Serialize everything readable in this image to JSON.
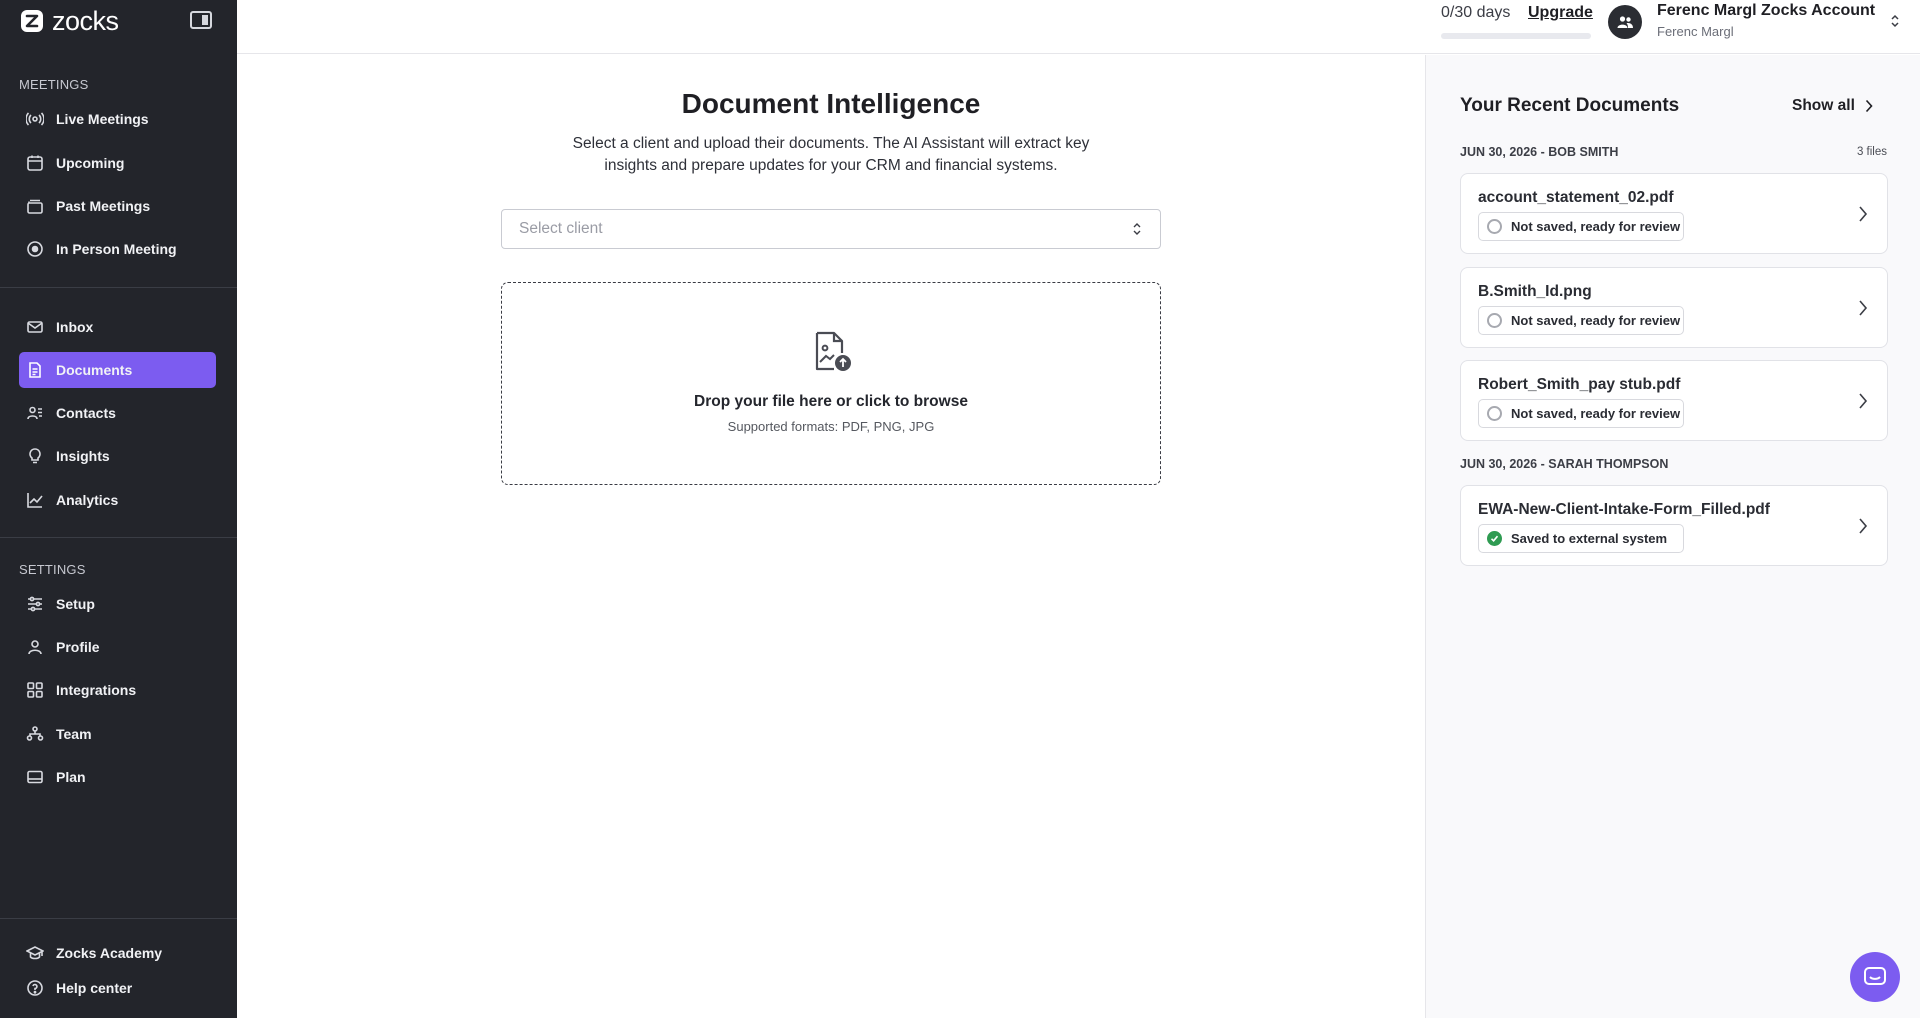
{
  "app": {
    "brand_name": "zocks"
  },
  "sidebar": {
    "meetings_label": "MEETINGS",
    "meetings_items": [
      {
        "label": "Live Meetings",
        "icon": "broadcast-icon"
      },
      {
        "label": "Upcoming",
        "icon": "calendar-icon"
      },
      {
        "label": "Past Meetings",
        "icon": "archive-icon"
      },
      {
        "label": "In Person Meeting",
        "icon": "record-icon"
      }
    ],
    "main_items": [
      {
        "label": "Inbox",
        "icon": "mail-icon"
      },
      {
        "label": "Documents",
        "icon": "document-icon",
        "active": true
      },
      {
        "label": "Contacts",
        "icon": "contacts-icon"
      },
      {
        "label": "Insights",
        "icon": "lightbulb-icon"
      },
      {
        "label": "Analytics",
        "icon": "chart-icon"
      }
    ],
    "settings_label": "SETTINGS",
    "settings_items": [
      {
        "label": "Setup",
        "icon": "sliders-icon"
      },
      {
        "label": "Profile",
        "icon": "user-icon"
      },
      {
        "label": "Integrations",
        "icon": "grid-icon"
      },
      {
        "label": "Team",
        "icon": "team-icon"
      },
      {
        "label": "Plan",
        "icon": "card-icon"
      }
    ],
    "footer_items": [
      {
        "label": "Zocks Academy",
        "icon": "graduation-icon"
      },
      {
        "label": "Help center",
        "icon": "help-icon"
      }
    ]
  },
  "topbar": {
    "trial_text": "0/30 days",
    "trial_progress": 0,
    "upgrade_label": "Upgrade",
    "account_name": "Ferenc Margl Zocks Account",
    "account_user": "Ferenc Margl"
  },
  "main": {
    "title": "Document Intelligence",
    "description": "Select a client and upload their documents. The AI Assistant will extract key insights and prepare updates for your CRM and financial systems.",
    "select_placeholder": "Select client",
    "dropzone_title": "Drop your file here or click to browse",
    "dropzone_formats": "Supported formats: PDF, PNG, JPG"
  },
  "recent": {
    "title": "Your Recent Documents",
    "show_all_label": "Show all",
    "groups": [
      {
        "label": "JUN 30, 2026 - BOB SMITH",
        "count": "3 files",
        "docs": [
          {
            "name": "account_statement_02.pdf",
            "status": "Not saved, ready for review",
            "saved": false
          },
          {
            "name": "B.Smith_Id.png",
            "status": "Not saved, ready for review",
            "saved": false
          },
          {
            "name": "Robert_Smith_pay stub.pdf",
            "status": "Not saved, ready for review",
            "saved": false
          }
        ]
      },
      {
        "label": "JUN 30, 2026 - SARAH THOMPSON",
        "count": "",
        "docs": [
          {
            "name": "EWA-New-Client-Intake-Form_Filled.pdf",
            "status": "Saved to external system",
            "saved": true
          }
        ]
      }
    ]
  },
  "colors": {
    "accent": "#7c5cf0",
    "sidebar_bg": "#23252b",
    "success": "#2f9b52"
  }
}
